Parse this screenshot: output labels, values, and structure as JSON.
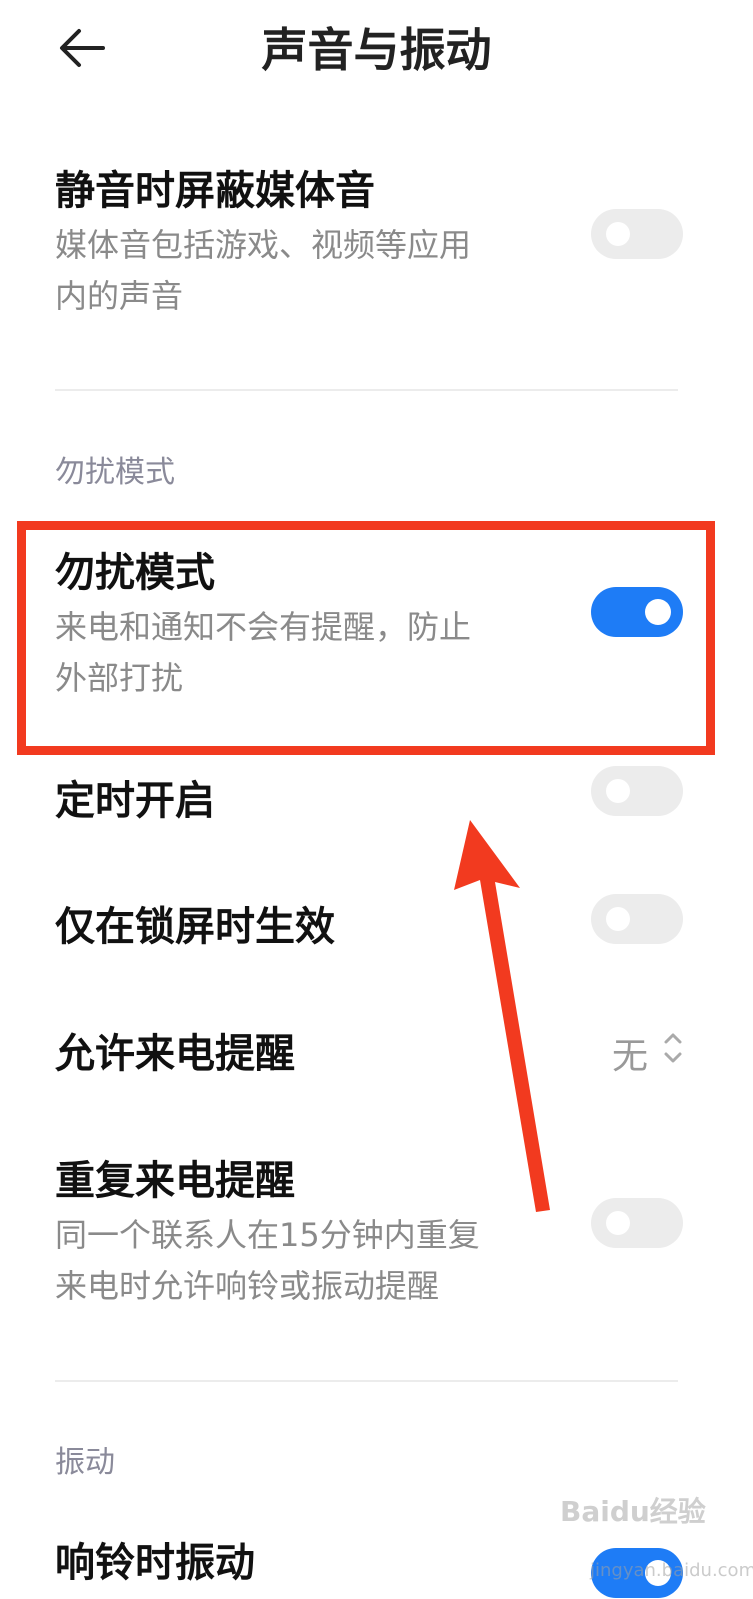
{
  "header": {
    "title": "声音与振动"
  },
  "items": {
    "mute_media": {
      "title": "静音时屏蔽媒体音",
      "desc_line1": "媒体音包括游戏、视频等应用",
      "desc_line2": "内的声音",
      "toggle": false
    },
    "dnd": {
      "title": "勿扰模式",
      "desc_line1": "来电和通知不会有提醒，防止",
      "desc_line2": "外部打扰",
      "toggle": true
    },
    "schedule": {
      "title": "定时开启",
      "toggle": false
    },
    "lockscreen_only": {
      "title": "仅在锁屏时生效",
      "toggle": false
    },
    "allow_calls": {
      "title": "允许来电提醒",
      "value": "无"
    },
    "repeat_calls": {
      "title": "重复来电提醒",
      "desc_line1": "同一个联系人在15分钟内重复",
      "desc_line2": "来电时允许响铃或振动提醒",
      "toggle": false
    },
    "ring_vibrate": {
      "title": "响铃时振动",
      "toggle": true
    }
  },
  "sections": {
    "dnd": "勿扰模式",
    "vibration": "振动"
  },
  "watermark": {
    "brand": "Baidu经验",
    "url": "jingyan.baidu.com"
  },
  "colors": {
    "accent": "#1e7cf6",
    "highlight": "#f23a1f",
    "toggle_off": "#ececec"
  }
}
